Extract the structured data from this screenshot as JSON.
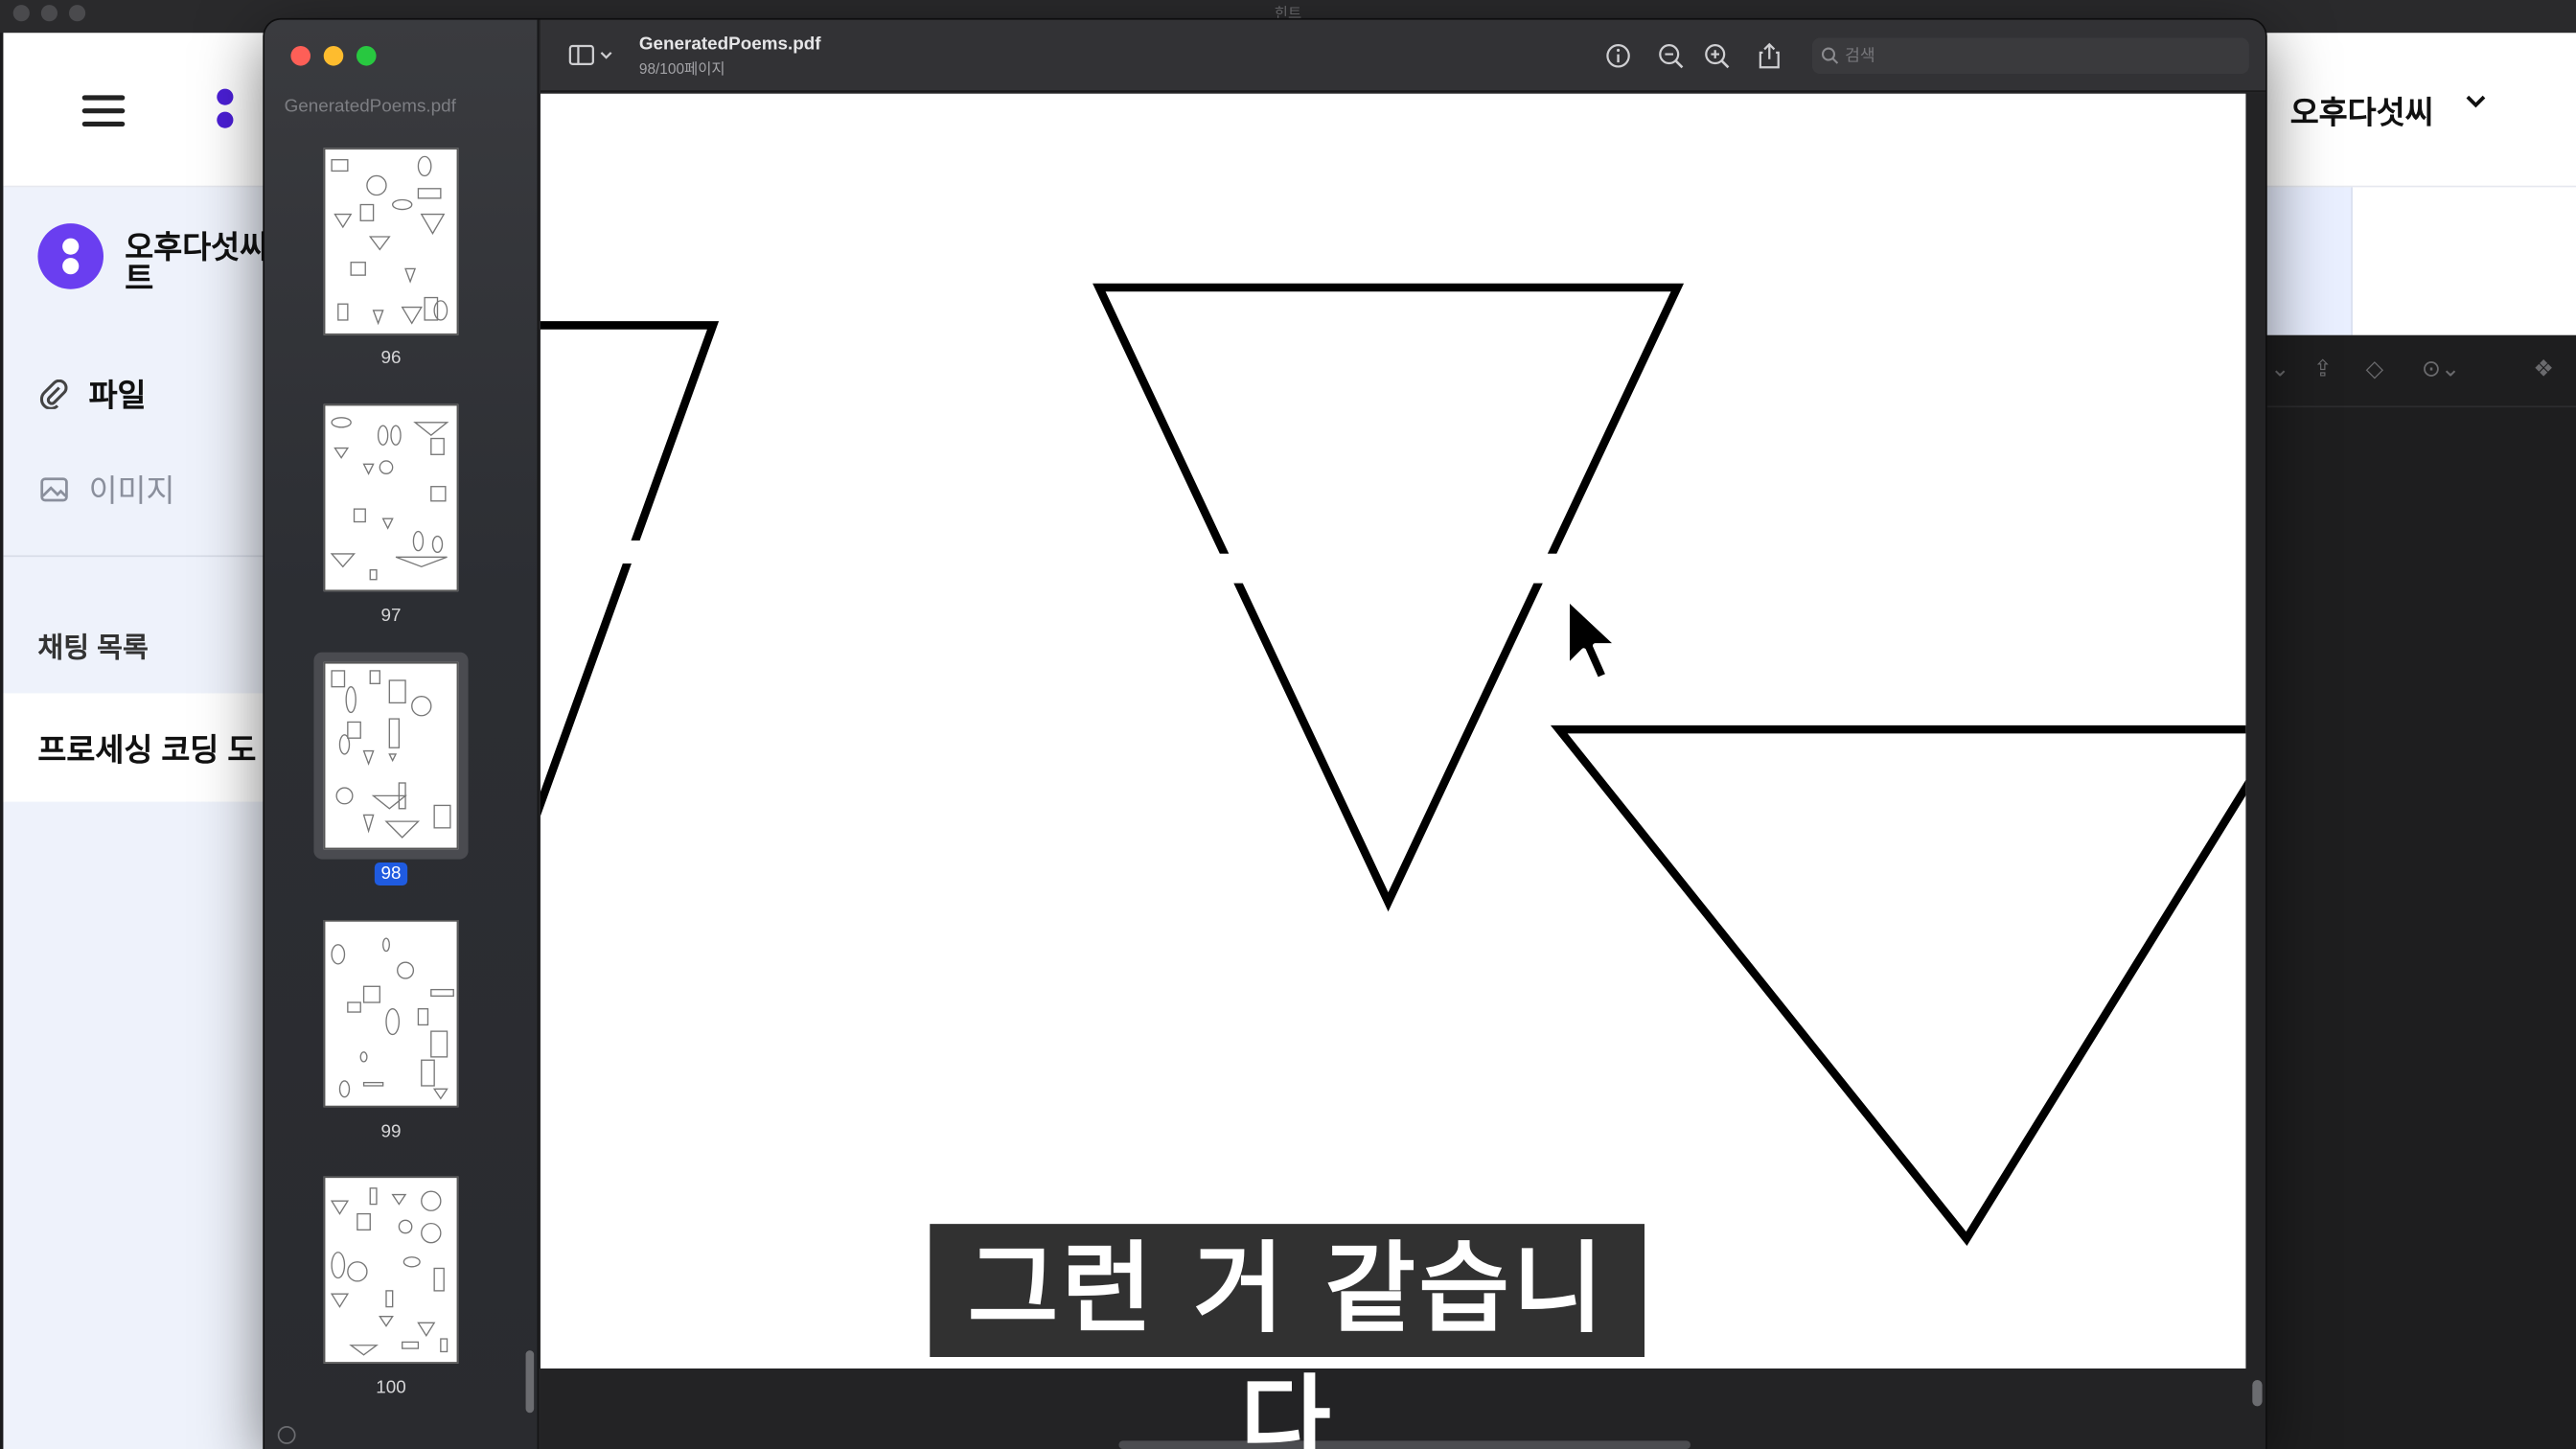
{
  "system_bar": {
    "title": "힌트"
  },
  "background_app": {
    "user_name": "오후다섯씨",
    "workspace_name": "오후다섯씨 트",
    "sidebar": {
      "file_label": "파일",
      "image_label": "이미지",
      "section_title": "채팅 목록",
      "chat_item": "프로세싱 코딩 도"
    }
  },
  "pdf_viewer": {
    "doc_title": "GeneratedPoems.pdf",
    "page_status": "98/100페이지",
    "sidebar_filename": "GeneratedPoems.pdf",
    "search_placeholder": "검색",
    "thumbnails": [
      {
        "label": "96",
        "selected": false
      },
      {
        "label": "97",
        "selected": false
      },
      {
        "label": "98",
        "selected": true
      },
      {
        "label": "99",
        "selected": false
      },
      {
        "label": "100",
        "selected": false
      }
    ],
    "toolbar_icons": [
      "sidebar-toggle-icon",
      "chevron-down-icon",
      "info-icon",
      "zoom-out-icon",
      "zoom-in-icon",
      "share-icon",
      "markup-pen-icon",
      "chevron-down-icon",
      "rotate-icon",
      "annotate-icon",
      "signature-icon",
      "search-icon"
    ]
  },
  "subtitle": {
    "text": "그런 거 같습니다"
  },
  "colors": {
    "close": "#fe5f57",
    "minimize": "#febc2e",
    "zoom": "#28c840",
    "selection": "#1f5be0",
    "brand": "#4b1fd6"
  }
}
